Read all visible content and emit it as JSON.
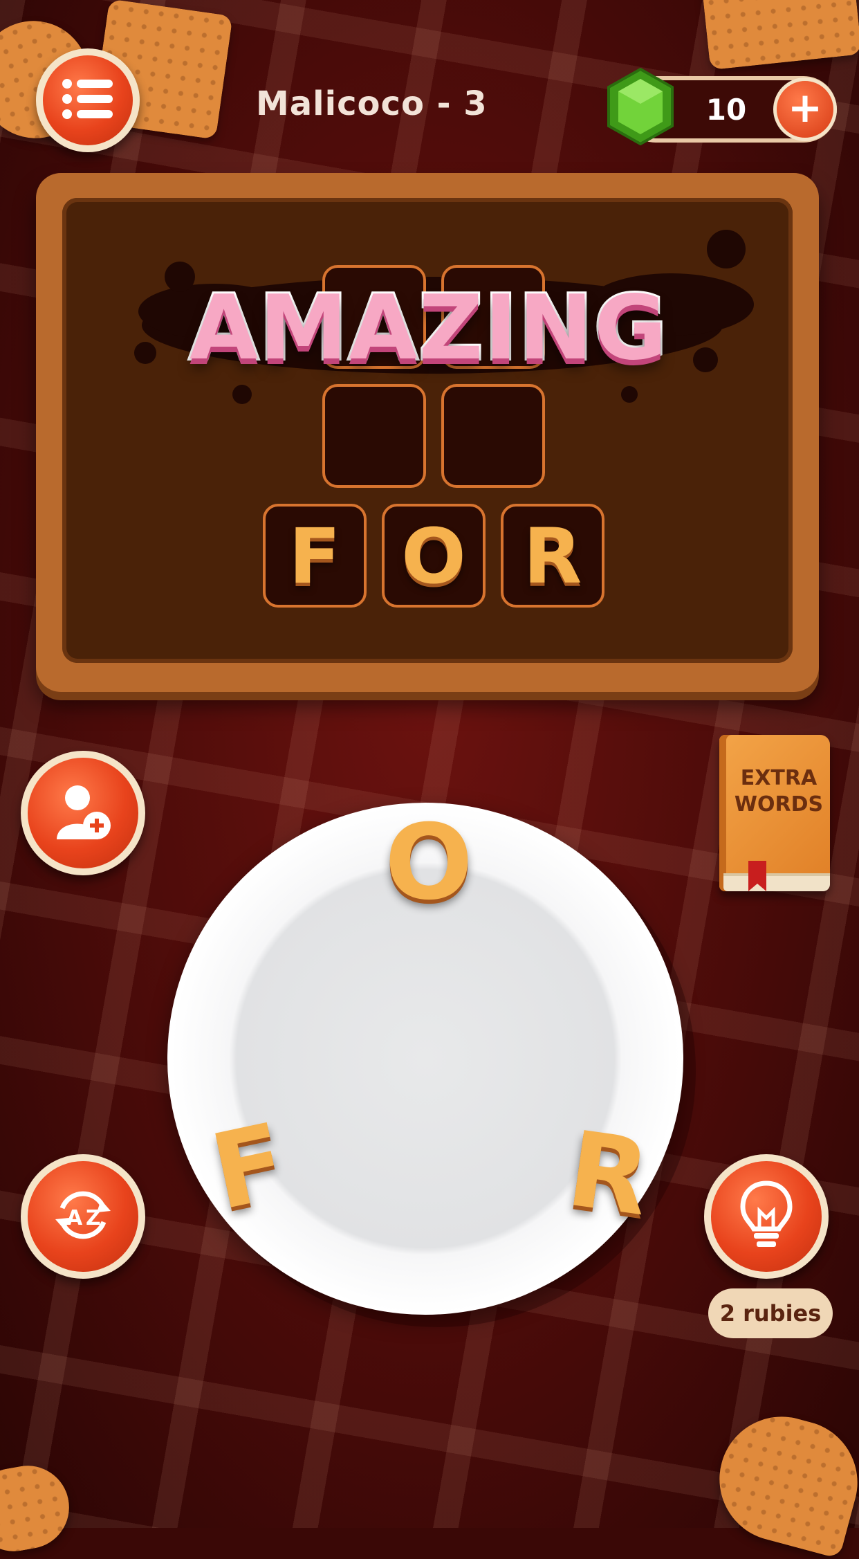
{
  "header": {
    "level_title": "Malicoco - 3",
    "ruby_count": "10",
    "add_rubies_label": "+"
  },
  "board": {
    "praise_text": "AMAZING",
    "grid": {
      "rows": [
        [
          "",
          ""
        ],
        [
          "",
          ""
        ]
      ]
    },
    "solved_word_letters": [
      "F",
      "O",
      "R"
    ]
  },
  "plate": {
    "letters": [
      "O",
      "F",
      "R"
    ]
  },
  "extra_words": {
    "label": "EXTRA\nWORDS"
  },
  "hint": {
    "cost_label": "2 rubies"
  },
  "icons": {
    "menu": "menu-list-icon",
    "gem": "green-gem-icon",
    "add": "plus-icon",
    "invite": "add-friend-icon",
    "shuffle": "shuffle-az-icon",
    "hint": "lightbulb-icon",
    "book": "book-icon"
  },
  "colors": {
    "background": "#4a0b09",
    "board_frame": "#b96a2d",
    "button_red": "#e8431c",
    "letter_biscuit": "#f6b24e",
    "praise_pink": "#f7a8c4",
    "gem_green": "#5fc02a"
  }
}
